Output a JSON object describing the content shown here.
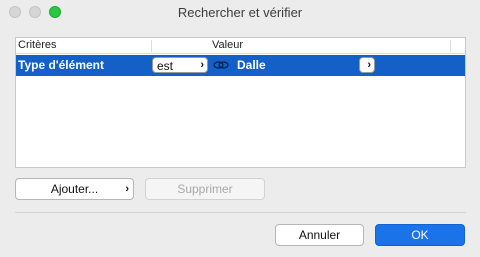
{
  "window": {
    "title": "Rechercher et vérifier"
  },
  "table": {
    "columns": [
      "Critères",
      "Valeur"
    ],
    "rows": [
      {
        "criterion": "Type d'élément",
        "operator": "est",
        "value": "Dalle",
        "link_icon": "link-icon",
        "selected": true
      }
    ]
  },
  "buttons": {
    "add": "Ajouter...",
    "delete": "Supprimer",
    "cancel": "Annuler",
    "ok": "OK"
  },
  "icons": {
    "chevron": "chevron-right-icon"
  },
  "colors": {
    "selection": "#1460c9",
    "accent": "#1a73e8",
    "maximize": "#2ac840"
  }
}
